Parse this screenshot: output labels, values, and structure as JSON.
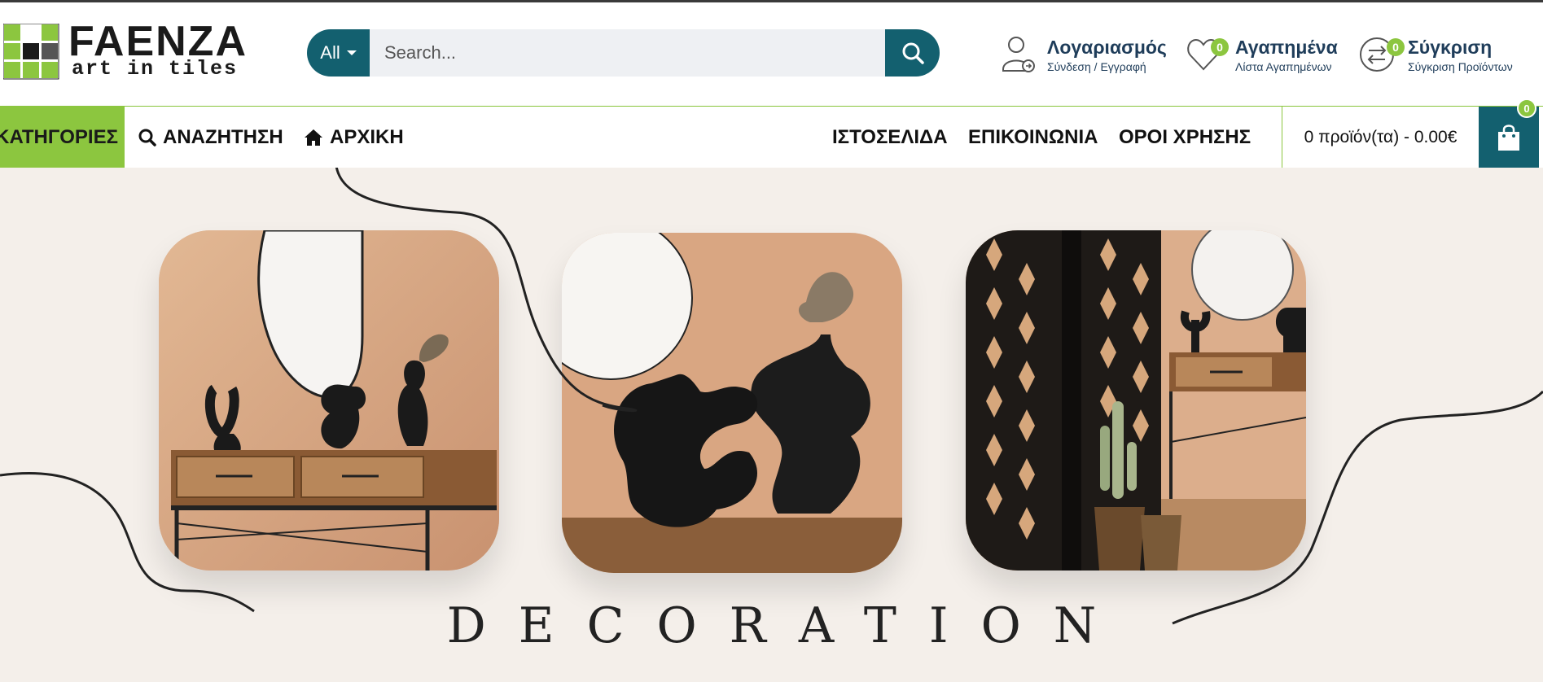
{
  "brand": {
    "name": "FAENZA",
    "tagline": "art in tiles",
    "colors": {
      "primary": "#13606f",
      "accent": "#8cc63f",
      "text": "#1f3d5a",
      "banner_bg": "#f4efea"
    }
  },
  "search": {
    "category_label": "All",
    "placeholder": "Search...",
    "button_icon": "search-icon"
  },
  "header_actions": {
    "account": {
      "title": "Λογαριασμός",
      "subtitle": "Σύνδεση / Εγγραφή",
      "icon": "user-icon"
    },
    "wishlist": {
      "title": "Αγαπημένα",
      "subtitle": "Λίστα Αγαπημένων",
      "count": "0",
      "icon": "heart-icon"
    },
    "compare": {
      "title": "Σύγκριση",
      "subtitle": "Σύγκριση Προϊόντων",
      "count": "0",
      "icon": "compare-arrows-icon"
    }
  },
  "nav": {
    "categories_label": "ΚΑΤΗΓΟΡΙΕΣ",
    "search_label": "ΑΝΑΖΗΤΗΣΗ",
    "home_label": "ΑΡΧΙΚΗ",
    "right_links": [
      "ΙΣΤΟΣΕΛΙΔΑ",
      "ΕΠΙΚΟΙΝΩΝΙΑ",
      "ΟΡΟΙ ΧΡΗΣΗΣ"
    ],
    "cart_summary": "0 προϊόν(τα) - 0.00€",
    "cart_count": "0"
  },
  "banner": {
    "caption": "DECORATION",
    "tiles": [
      "console-table-mirror-vases",
      "black-sculptural-vases",
      "carved-screen-console-cactus"
    ]
  }
}
